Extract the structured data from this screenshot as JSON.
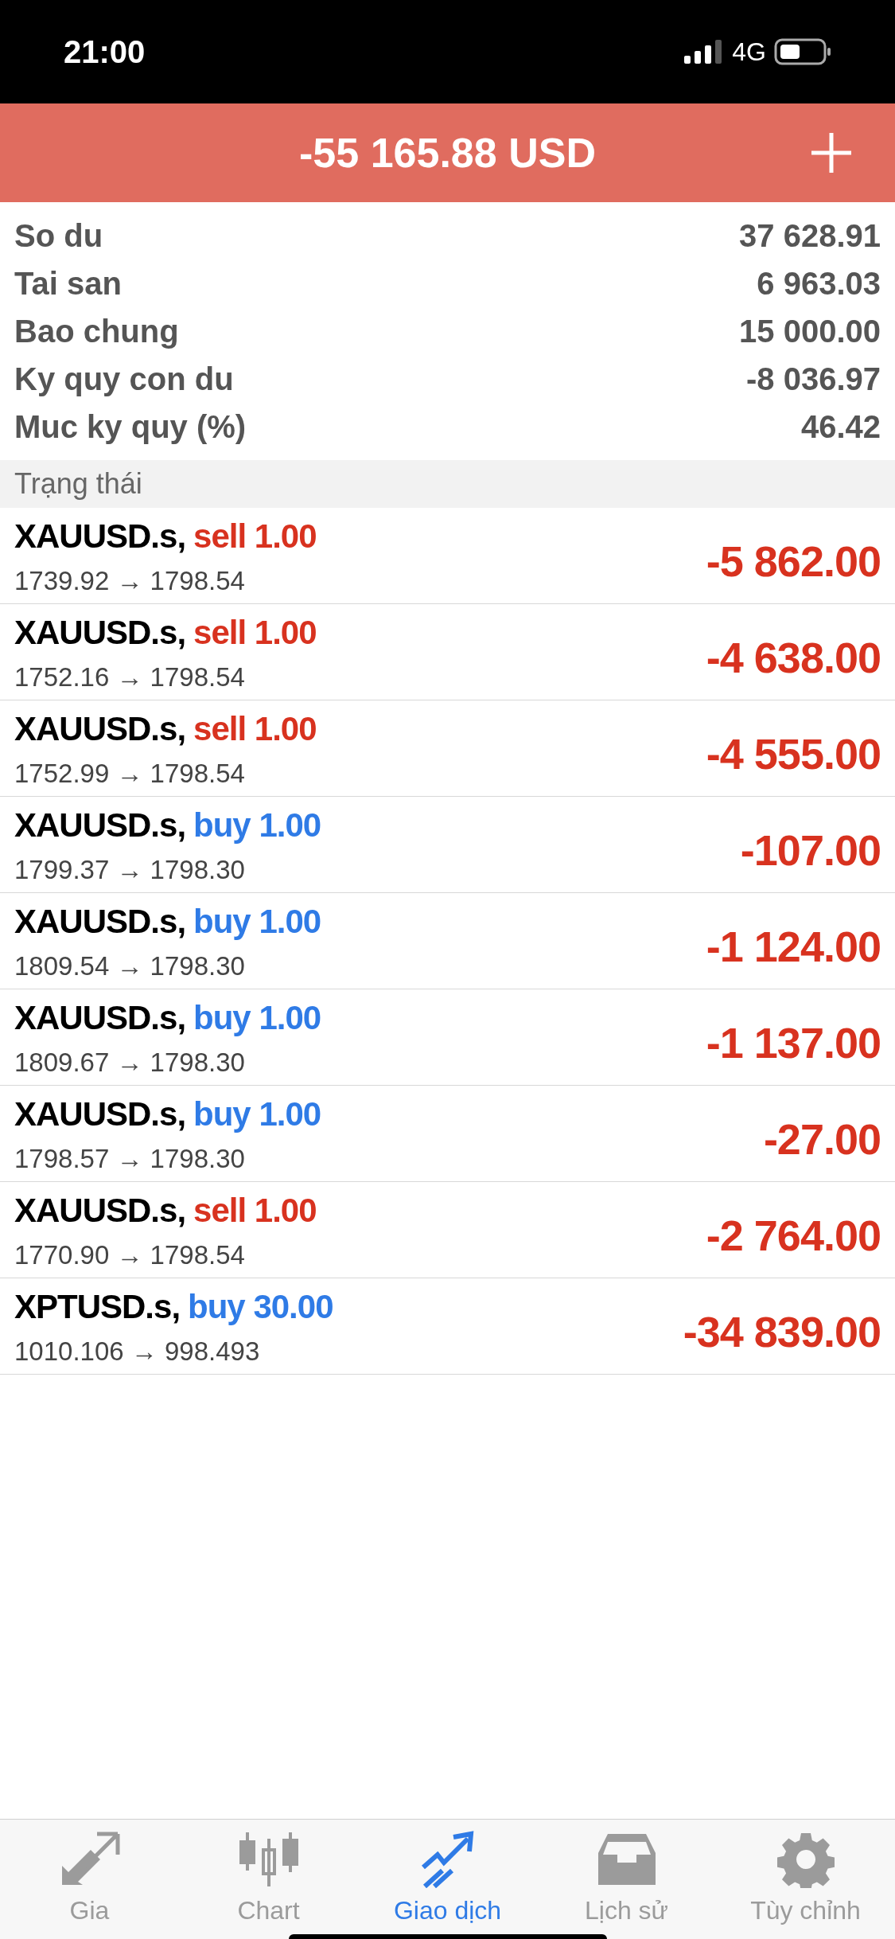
{
  "status_bar": {
    "time": "21:00",
    "network": "4G"
  },
  "header": {
    "total": "-55 165.88 USD"
  },
  "summary": [
    {
      "label": "So du",
      "value": "37 628.91"
    },
    {
      "label": "Tai san",
      "value": "6 963.03"
    },
    {
      "label": "Bao chung",
      "value": "15 000.00"
    },
    {
      "label": "Ky quy con du",
      "value": "-8 036.97"
    },
    {
      "label": "Muc ky quy (%)",
      "value": "46.42"
    }
  ],
  "section_title": "Trạng thái",
  "positions": [
    {
      "symbol": "XAUUSD.s,",
      "kind": "sell",
      "order": "sell 1.00",
      "prices": "1739.92 → 1798.54",
      "profit": "-5 862.00"
    },
    {
      "symbol": "XAUUSD.s,",
      "kind": "sell",
      "order": "sell 1.00",
      "prices": "1752.16 → 1798.54",
      "profit": "-4 638.00"
    },
    {
      "symbol": "XAUUSD.s,",
      "kind": "sell",
      "order": "sell 1.00",
      "prices": "1752.99 → 1798.54",
      "profit": "-4 555.00"
    },
    {
      "symbol": "XAUUSD.s,",
      "kind": "buy",
      "order": "buy 1.00",
      "prices": "1799.37 → 1798.30",
      "profit": "-107.00"
    },
    {
      "symbol": "XAUUSD.s,",
      "kind": "buy",
      "order": "buy 1.00",
      "prices": "1809.54 → 1798.30",
      "profit": "-1 124.00"
    },
    {
      "symbol": "XAUUSD.s,",
      "kind": "buy",
      "order": "buy 1.00",
      "prices": "1809.67 → 1798.30",
      "profit": "-1 137.00"
    },
    {
      "symbol": "XAUUSD.s,",
      "kind": "buy",
      "order": "buy 1.00",
      "prices": "1798.57 → 1798.30",
      "profit": "-27.00"
    },
    {
      "symbol": "XAUUSD.s,",
      "kind": "sell",
      "order": "sell 1.00",
      "prices": "1770.90 → 1798.54",
      "profit": "-2 764.00"
    },
    {
      "symbol": "XPTUSD.s,",
      "kind": "buy",
      "order": "buy 30.00",
      "prices": "1010.106 → 998.493",
      "profit": "-34 839.00"
    }
  ],
  "tabs": [
    {
      "label": "Gia",
      "kind": "quotes",
      "selected": false
    },
    {
      "label": "Chart",
      "kind": "chart",
      "selected": false
    },
    {
      "label": "Giao dịch",
      "kind": "trade",
      "selected": true
    },
    {
      "label": "Lịch sử",
      "kind": "history",
      "selected": false
    },
    {
      "label": "Tùy chỉnh",
      "kind": "settings",
      "selected": false
    }
  ]
}
